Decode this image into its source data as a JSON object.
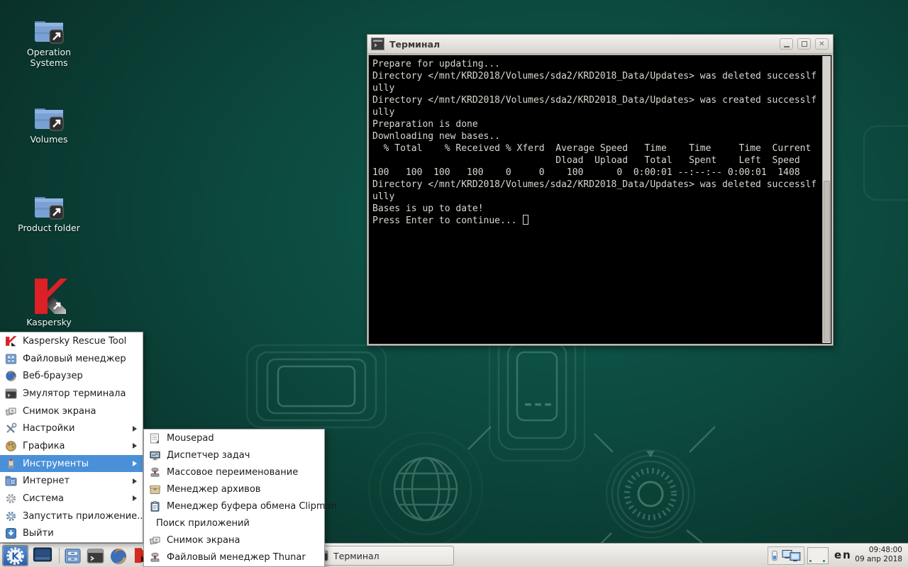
{
  "colors": {
    "selection_blue": "#4a90d9",
    "desktop_teal": "#0c4a3f",
    "terminal_background": "#000000",
    "terminal_text": "#d8d8d0",
    "taskbar_gray": "#e6e3df",
    "kaspersky_red": "#dd1f26"
  },
  "desktop": {
    "icons": [
      {
        "label": "Operation Systems"
      },
      {
        "label": "Volumes"
      },
      {
        "label": "Product folder"
      },
      {
        "label": "Kaspersky"
      }
    ]
  },
  "terminal": {
    "title": "Терминал",
    "window_buttons": [
      "minimize",
      "maximize",
      "close"
    ],
    "lines": [
      "Prepare for updating...",
      "Directory </mnt/KRD2018/Volumes/sda2/KRD2018_Data/Updates> was deleted successlf",
      "ully",
      "Directory </mnt/KRD2018/Volumes/sda2/KRD2018_Data/Updates> was created successlf",
      "ully",
      "Preparation is done",
      "Downloading new bases..",
      "  % Total    % Received % Xferd  Average Speed   Time    Time     Time  Current",
      "                                 Dload  Upload   Total   Spent    Left  Speed",
      "100   100  100   100    0     0    100      0  0:00:01 --:--:-- 0:00:01  1408",
      "Directory </mnt/KRD2018/Volumes/sda2/KRD2018_Data/Updates> was deleted successlf",
      "ully",
      "Bases is up to date!",
      "Press Enter to continue... "
    ]
  },
  "menu": {
    "items": [
      {
        "label": "Kaspersky Rescue Tool"
      },
      {
        "label": "Файловый менеджер"
      },
      {
        "label": "Веб-браузер"
      },
      {
        "label": "Эмулятор терминала"
      },
      {
        "label": "Снимок экрана"
      },
      {
        "label": "Настройки",
        "has_submenu": true
      },
      {
        "label": "Графика",
        "has_submenu": true
      },
      {
        "label": "Инструменты",
        "has_submenu": true,
        "highlighted": true
      },
      {
        "label": "Интернет",
        "has_submenu": true
      },
      {
        "label": "Система",
        "has_submenu": true
      },
      {
        "label": "Запустить приложение..."
      },
      {
        "label": "Выйти"
      }
    ]
  },
  "submenu": {
    "items": [
      {
        "label": "Mousepad"
      },
      {
        "label": "Диспетчер задач"
      },
      {
        "label": "Массовое переименование"
      },
      {
        "label": "Менеджер архивов"
      },
      {
        "label": "Менеджер буфера обмена Clipman"
      },
      {
        "label": "Поиск приложений"
      },
      {
        "label": "Снимок экрана"
      },
      {
        "label": "Файловый менеджер Thunar"
      }
    ]
  },
  "taskbar": {
    "window_button_label": "Терминал",
    "keyboard_layout": "en",
    "clock": {
      "time": "09:48:00",
      "date": "09 апр 2018"
    }
  }
}
